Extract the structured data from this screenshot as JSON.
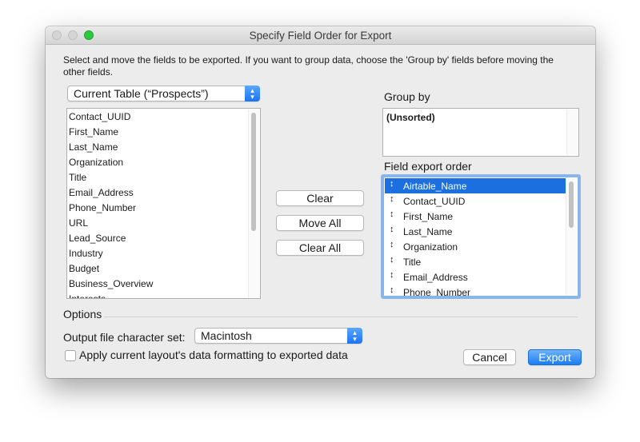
{
  "window": {
    "title": "Specify Field Order for Export"
  },
  "instructions": "Select and move the fields to be exported.  If you want to group data, choose the 'Group by' fields before moving the other fields.",
  "table_select": {
    "value": "Current Table (“Prospects”)"
  },
  "available_fields": [
    "Contact_UUID",
    "First_Name",
    "Last_Name",
    "Organization",
    "Title",
    "Email_Address",
    "Phone_Number",
    "URL",
    "Lead_Source",
    "Industry",
    "Budget",
    "Business_Overview",
    "Interests"
  ],
  "buttons": {
    "clear": "Clear",
    "move_all": "Move All",
    "clear_all": "Clear All",
    "cancel": "Cancel",
    "export": "Export"
  },
  "group_by": {
    "label": "Group by",
    "items": [
      "(Unsorted)"
    ]
  },
  "field_export_order": {
    "label": "Field export order",
    "selected_index": 0,
    "items": [
      "Airtable_Name",
      "Contact_UUID",
      "First_Name",
      "Last_Name",
      "Organization",
      "Title",
      "Email_Address",
      "Phone_Number"
    ]
  },
  "options": {
    "label": "Options",
    "charset_label": "Output file character set:",
    "charset_value": "Macintosh",
    "apply_formatting_label": "Apply current layout's data formatting to exported data",
    "apply_formatting_checked": false
  },
  "icons": {
    "drag_handle": "↕",
    "popup_arrows": "▴▾"
  },
  "colors": {
    "accent": "#1b6fdf",
    "zoom": "#2bc840"
  }
}
